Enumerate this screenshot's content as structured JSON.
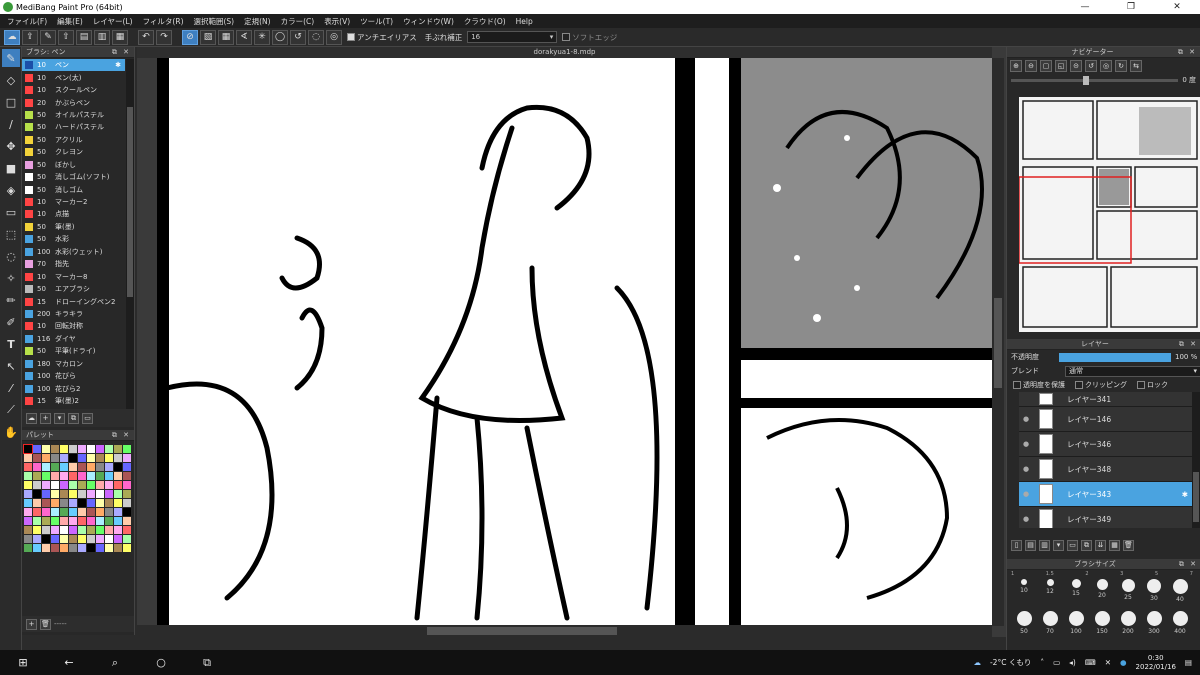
{
  "window": {
    "title": "MediBang Paint Pro (64bit)",
    "min": "—",
    "max": "❐",
    "close": "✕"
  },
  "menu": [
    "ファイル(F)",
    "編集(E)",
    "レイヤー(L)",
    "フィルタ(R)",
    "選択範囲(S)",
    "定規(N)",
    "カラー(C)",
    "表示(V)",
    "ツール(T)",
    "ウィンドウ(W)",
    "クラウド(O)",
    "Help"
  ],
  "toolbar": {
    "antialias": "アンチエイリアス",
    "stabilizer": "手ぶれ補正",
    "stabilizer_value": "16",
    "soft_edge": "ソフトエッジ"
  },
  "brush_panel": {
    "title": "ブラシ: ペン",
    "items": [
      {
        "size": "10",
        "name": "ペン",
        "color": "#1b4fa8"
      },
      {
        "size": "10",
        "name": "ペン(太)",
        "color": "#ff4444"
      },
      {
        "size": "10",
        "name": "スクールペン",
        "color": "#ff4444"
      },
      {
        "size": "20",
        "name": "かぶらペン",
        "color": "#ff4444"
      },
      {
        "size": "50",
        "name": "オイルパステル",
        "color": "#b7e04a"
      },
      {
        "size": "50",
        "name": "ハードパステル",
        "color": "#b7e04a"
      },
      {
        "size": "50",
        "name": "アクリル",
        "color": "#f2d23a"
      },
      {
        "size": "50",
        "name": "クレヨン",
        "color": "#f2d23a"
      },
      {
        "size": "50",
        "name": "ぼかし",
        "color": "#e8a0e0"
      },
      {
        "size": "50",
        "name": "消しゴム(ソフト)",
        "color": "#ffffff"
      },
      {
        "size": "50",
        "name": "消しゴム",
        "color": "#ffffff"
      },
      {
        "size": "10",
        "name": "マーカー2",
        "color": "#ff4444"
      },
      {
        "size": "10",
        "name": "点描",
        "color": "#ff4444"
      },
      {
        "size": "50",
        "name": "筆(墨)",
        "color": "#f2d23a"
      },
      {
        "size": "50",
        "name": "水彩",
        "color": "#4aa3e0"
      },
      {
        "size": "100",
        "name": "水彩(ウェット)",
        "color": "#4aa3e0"
      },
      {
        "size": "70",
        "name": "指先",
        "color": "#e8a0e0"
      },
      {
        "size": "10",
        "name": "マーカー8",
        "color": "#ff4444"
      },
      {
        "size": "50",
        "name": "エアブラシ",
        "color": "#bbbbbb"
      },
      {
        "size": "15",
        "name": "ドローイングペン2",
        "color": "#ff4444"
      },
      {
        "size": "200",
        "name": "キラキラ",
        "color": "#4aa3e0"
      },
      {
        "size": "10",
        "name": "回転対称",
        "color": "#ff4444"
      },
      {
        "size": "116",
        "name": "ダイヤ",
        "color": "#4aa3e0"
      },
      {
        "size": "50",
        "name": "平筆(ドライ)",
        "color": "#b7e04a"
      },
      {
        "size": "180",
        "name": "マカロン",
        "color": "#4aa3e0"
      },
      {
        "size": "100",
        "name": "花びら",
        "color": "#4aa3e0"
      },
      {
        "size": "100",
        "name": "花びら2",
        "color": "#4aa3e0"
      },
      {
        "size": "15",
        "name": "筆(墨)2",
        "color": "#ff4444"
      }
    ]
  },
  "palette": {
    "title": "パレット",
    "footer_text": "-----"
  },
  "canvas": {
    "doc_title": "dorakyua1-8.mdp"
  },
  "navigator": {
    "title": "ナビゲーター",
    "angle": "0 度"
  },
  "layer_panel": {
    "title": "レイヤー",
    "opacity_label": "不透明度",
    "opacity_value": "100 %",
    "opacity_fraction": 1.0,
    "blend_label": "ブレンド",
    "blend_value": "通常",
    "protect_alpha": "透明度を保護",
    "clipping": "クリッピング",
    "lock": "ロック",
    "layers": [
      {
        "name": "レイヤー341",
        "selected": false
      },
      {
        "name": "レイヤー146",
        "selected": false
      },
      {
        "name": "レイヤー346",
        "selected": false
      },
      {
        "name": "レイヤー348",
        "selected": false
      },
      {
        "name": "レイヤー343",
        "selected": true
      },
      {
        "name": "レイヤー349",
        "selected": false
      }
    ]
  },
  "brush_size_panel": {
    "title": "ブラシサイズ",
    "ruler": [
      "1",
      "1.5",
      "2",
      "3",
      "5",
      "7"
    ],
    "sizes": [
      "10",
      "12",
      "15",
      "20",
      "25",
      "30",
      "40",
      "50",
      "70",
      "100",
      "150",
      "200",
      "300",
      "400"
    ]
  },
  "taskbar": {
    "weather": "-2°C くもり",
    "time": "0:30",
    "date": "2022/01/16"
  }
}
